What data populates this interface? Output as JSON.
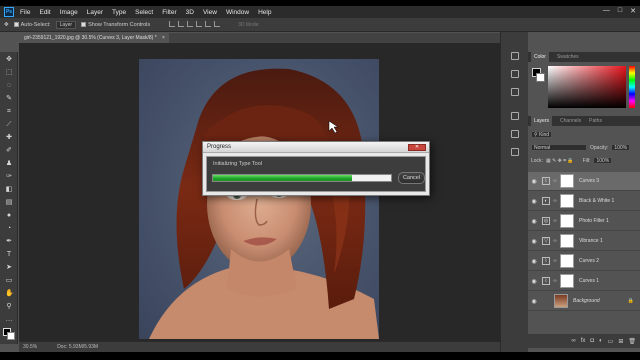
{
  "app": {
    "logo": "Ps",
    "menu": [
      "File",
      "Edit",
      "Image",
      "Layer",
      "Type",
      "Select",
      "Filter",
      "3D",
      "View",
      "Window",
      "Help"
    ],
    "window_controls": [
      "—",
      "□",
      "✕"
    ]
  },
  "options_bar": {
    "auto_select_label": "Auto-Select:",
    "auto_select_value": "Layer",
    "show_transform_label": "Show Transform Controls",
    "mode_3d_label": "3D Mode:"
  },
  "document": {
    "tab_title": "girl-2359121_1920.jpg @ 30.5% (Curves 3, Layer Mask/8) *",
    "tab_close": "×"
  },
  "status_bar": {
    "zoom": "30.5%",
    "doc_size": "Doc: 5.93M/5.93M"
  },
  "tools": [
    "move-tool",
    "marquee-tool",
    "lasso-tool",
    "quick-select-tool",
    "crop-tool",
    "eyedropper-tool",
    "healing-tool",
    "brush-tool",
    "clone-stamp-tool",
    "history-brush-tool",
    "eraser-tool",
    "gradient-tool",
    "blur-tool",
    "dodge-tool",
    "pen-tool",
    "type-tool",
    "path-select-tool",
    "shape-tool",
    "hand-tool",
    "zoom-tool"
  ],
  "color_panel": {
    "tabs": [
      "Color",
      "Swatches"
    ],
    "accent": "#e8141c"
  },
  "layers_panel": {
    "tabs": [
      "Layers",
      "Channels",
      "Paths"
    ],
    "kind_label": "Kind",
    "blend_mode": "Normal",
    "opacity_label": "Opacity:",
    "opacity_value": "100%",
    "lock_label": "Lock:",
    "fill_label": "Fill:",
    "fill_value": "100%",
    "layers": [
      {
        "name": "Curves 3",
        "type": "adjustment",
        "selected": true
      },
      {
        "name": "Black & White 1",
        "type": "adjustment",
        "selected": false
      },
      {
        "name": "Photo Filter 1",
        "type": "adjustment",
        "selected": false
      },
      {
        "name": "Vibrance 1",
        "type": "adjustment",
        "selected": false
      },
      {
        "name": "Curves 2",
        "type": "adjustment",
        "selected": false
      },
      {
        "name": "Curves 1",
        "type": "adjustment",
        "selected": false
      },
      {
        "name": "Background",
        "type": "image",
        "selected": false
      }
    ],
    "footer_icons": [
      "link-icon",
      "fx-icon",
      "mask-icon",
      "adjustment-icon",
      "folder-icon",
      "new-layer-icon",
      "trash-icon"
    ]
  },
  "progress_dialog": {
    "title": "Progress",
    "message": "Initializing Type Tool",
    "progress": 0.78,
    "cancel_label": "Cancel",
    "close_label": "✕"
  }
}
